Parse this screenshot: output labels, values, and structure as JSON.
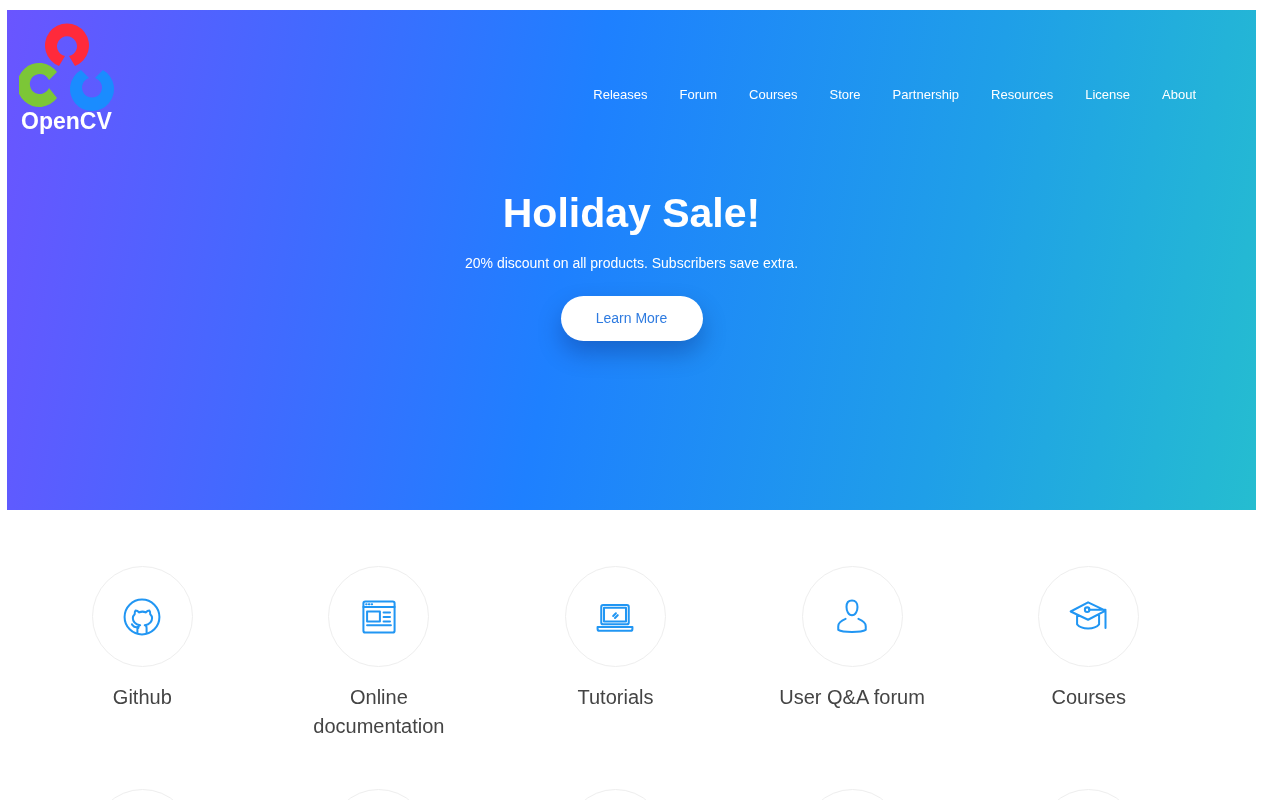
{
  "logo": {
    "text": "OpenCV"
  },
  "nav": [
    "Releases",
    "Forum",
    "Courses",
    "Store",
    "Partnership",
    "Resources",
    "License",
    "About"
  ],
  "hero": {
    "title": "Holiday Sale!",
    "subtitle": "20% discount on all products. Subscribers save extra.",
    "button": "Learn More"
  },
  "features": [
    {
      "kind": "github",
      "label": "Github"
    },
    {
      "kind": "docs",
      "label": "Online documentation"
    },
    {
      "kind": "laptop",
      "label": "Tutorials"
    },
    {
      "kind": "user",
      "label": "User Q&A forum"
    },
    {
      "kind": "cap",
      "label": "Courses"
    }
  ]
}
